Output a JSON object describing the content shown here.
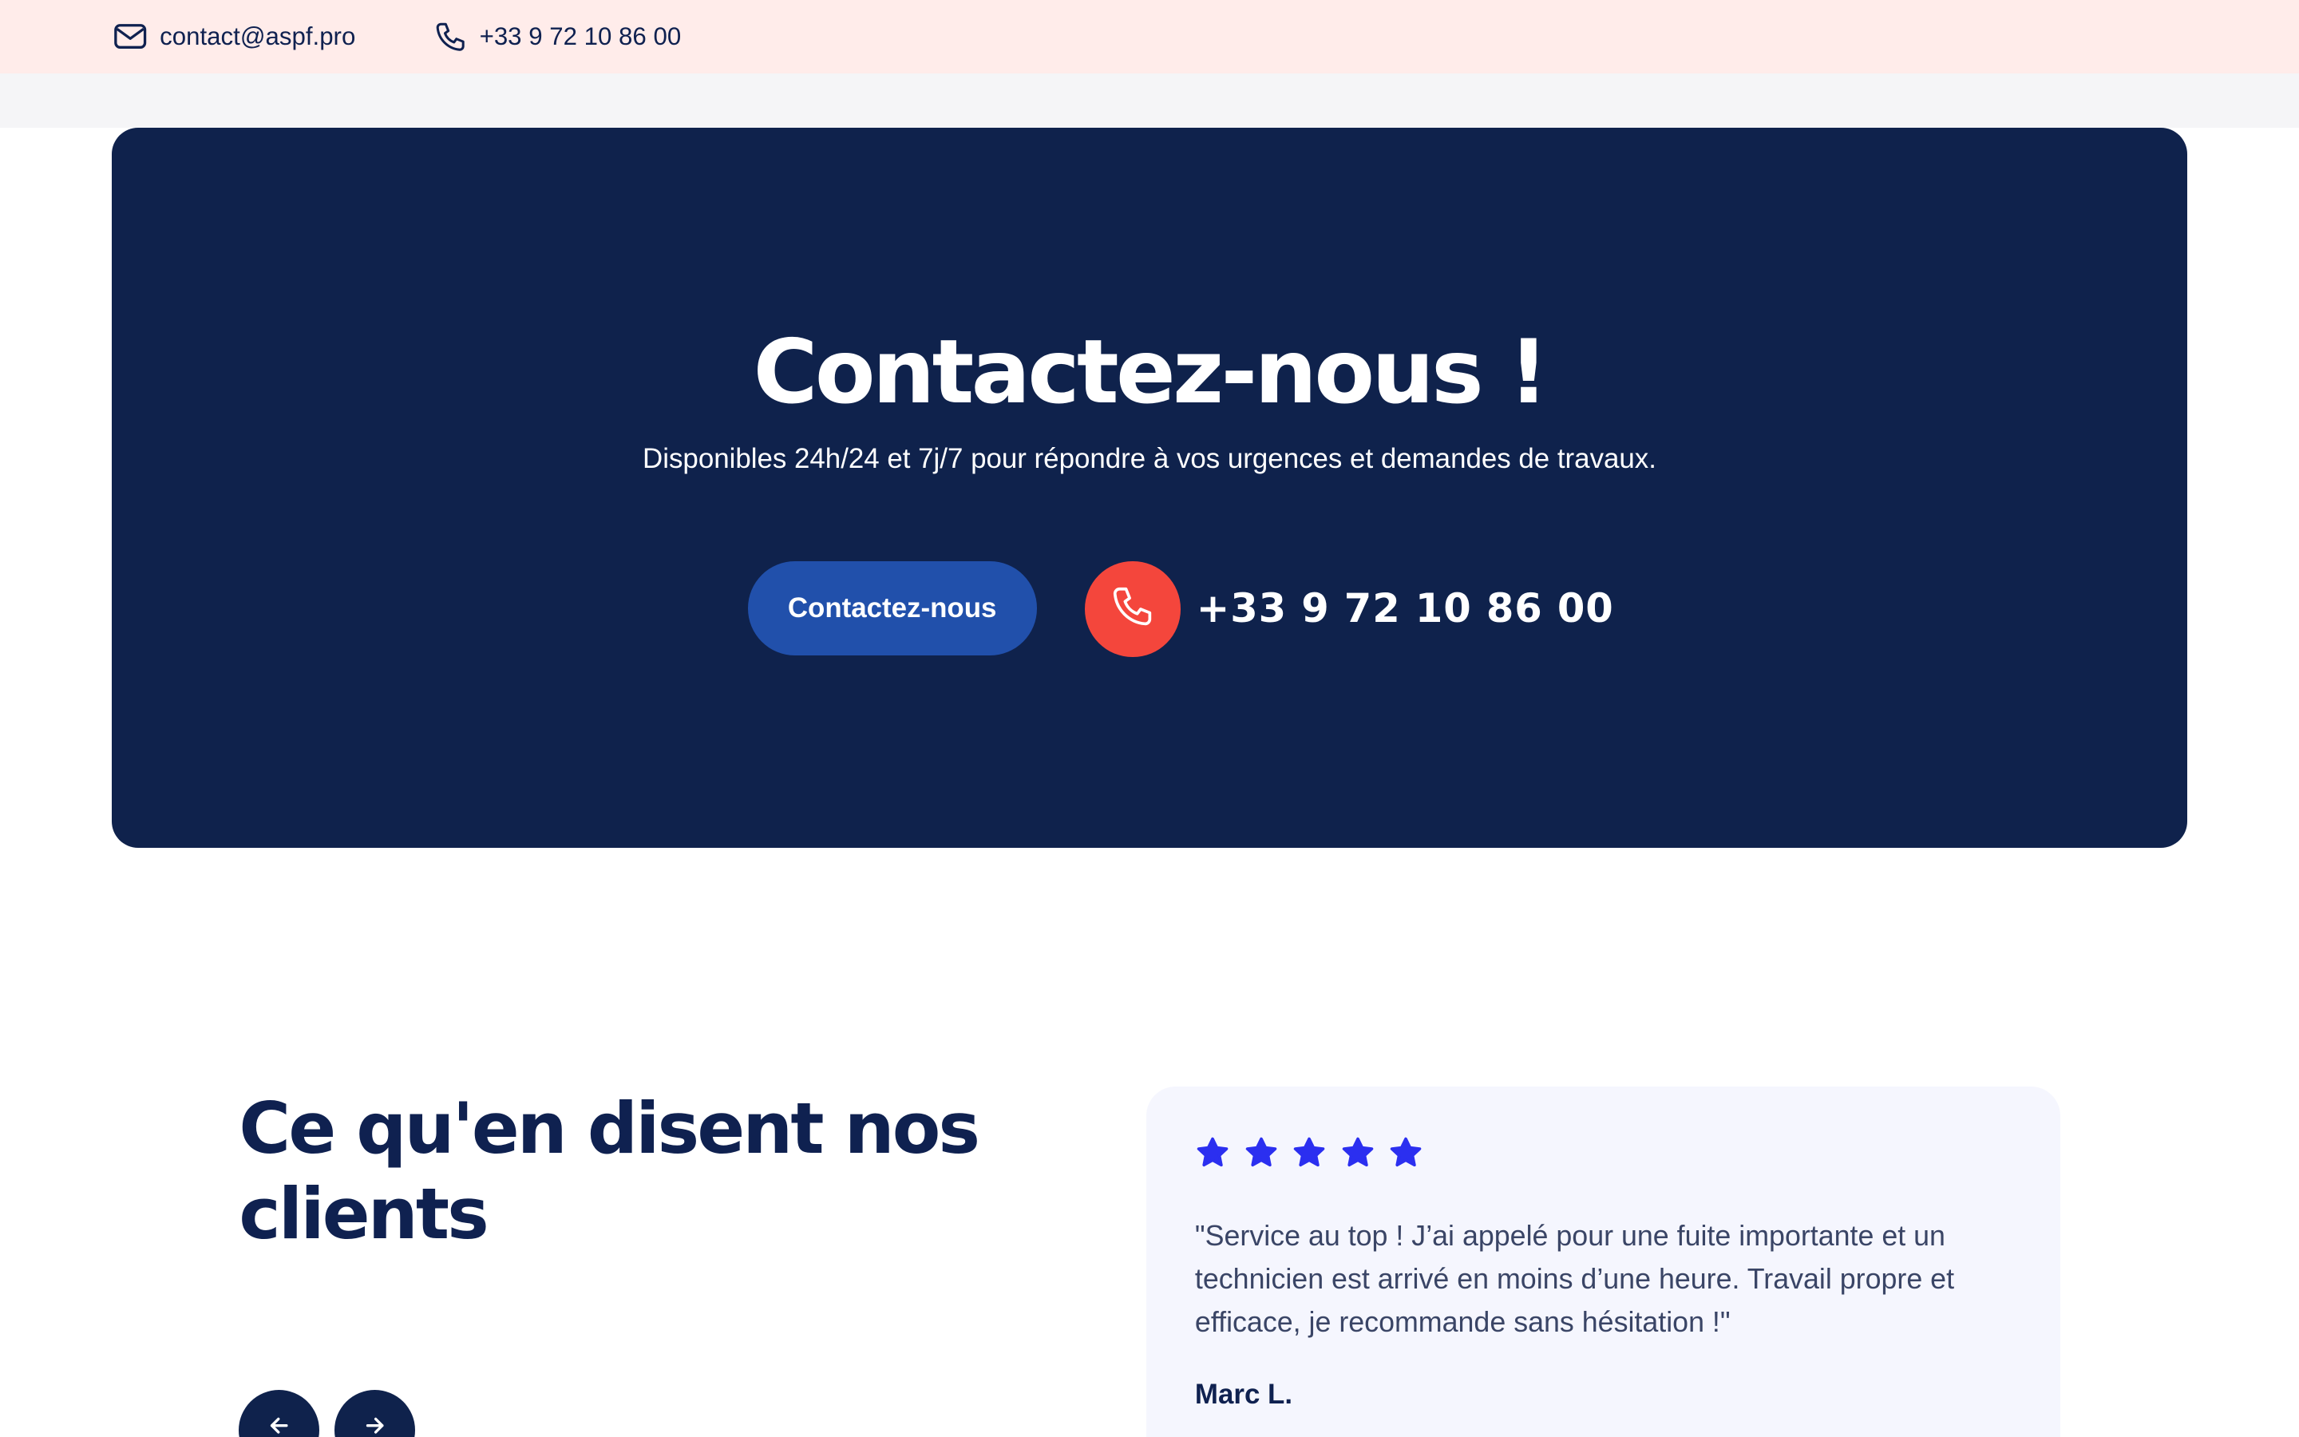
{
  "topbar": {
    "email": "contact@aspf.pro",
    "phone": "+33 9 72 10 86 00",
    "email_icon": "mail-icon",
    "phone_icon": "phone-icon"
  },
  "cta": {
    "title": "Contactez-nous !",
    "subtitle": "Disponibles 24h/24 et 7j/7 pour répondre à vos urgences et demandes de travaux.",
    "button_label": "Contactez-nous",
    "phone_number": "+33 9 72 10 86 00",
    "phone_icon": "phone-icon"
  },
  "testimonials": {
    "title": "Ce qu'en disent nos clients",
    "prev_icon": "arrow-left-icon",
    "next_icon": "arrow-right-icon",
    "review": {
      "rating": 5,
      "text": "\"Service au top ! J’ai appelé pour une fuite importante et un technicien est arrivé en moins d’une heure. Travail propre et efficace, je recommande sans hésitation !\"",
      "author": "Marc L."
    }
  },
  "colors": {
    "topbar_bg": "#ffecea",
    "navy": "#0f224c",
    "button_blue": "#2150ab",
    "phone_red": "#f4463c",
    "star_blue": "#2b2ff0",
    "card_bg": "#f5f6fe"
  }
}
